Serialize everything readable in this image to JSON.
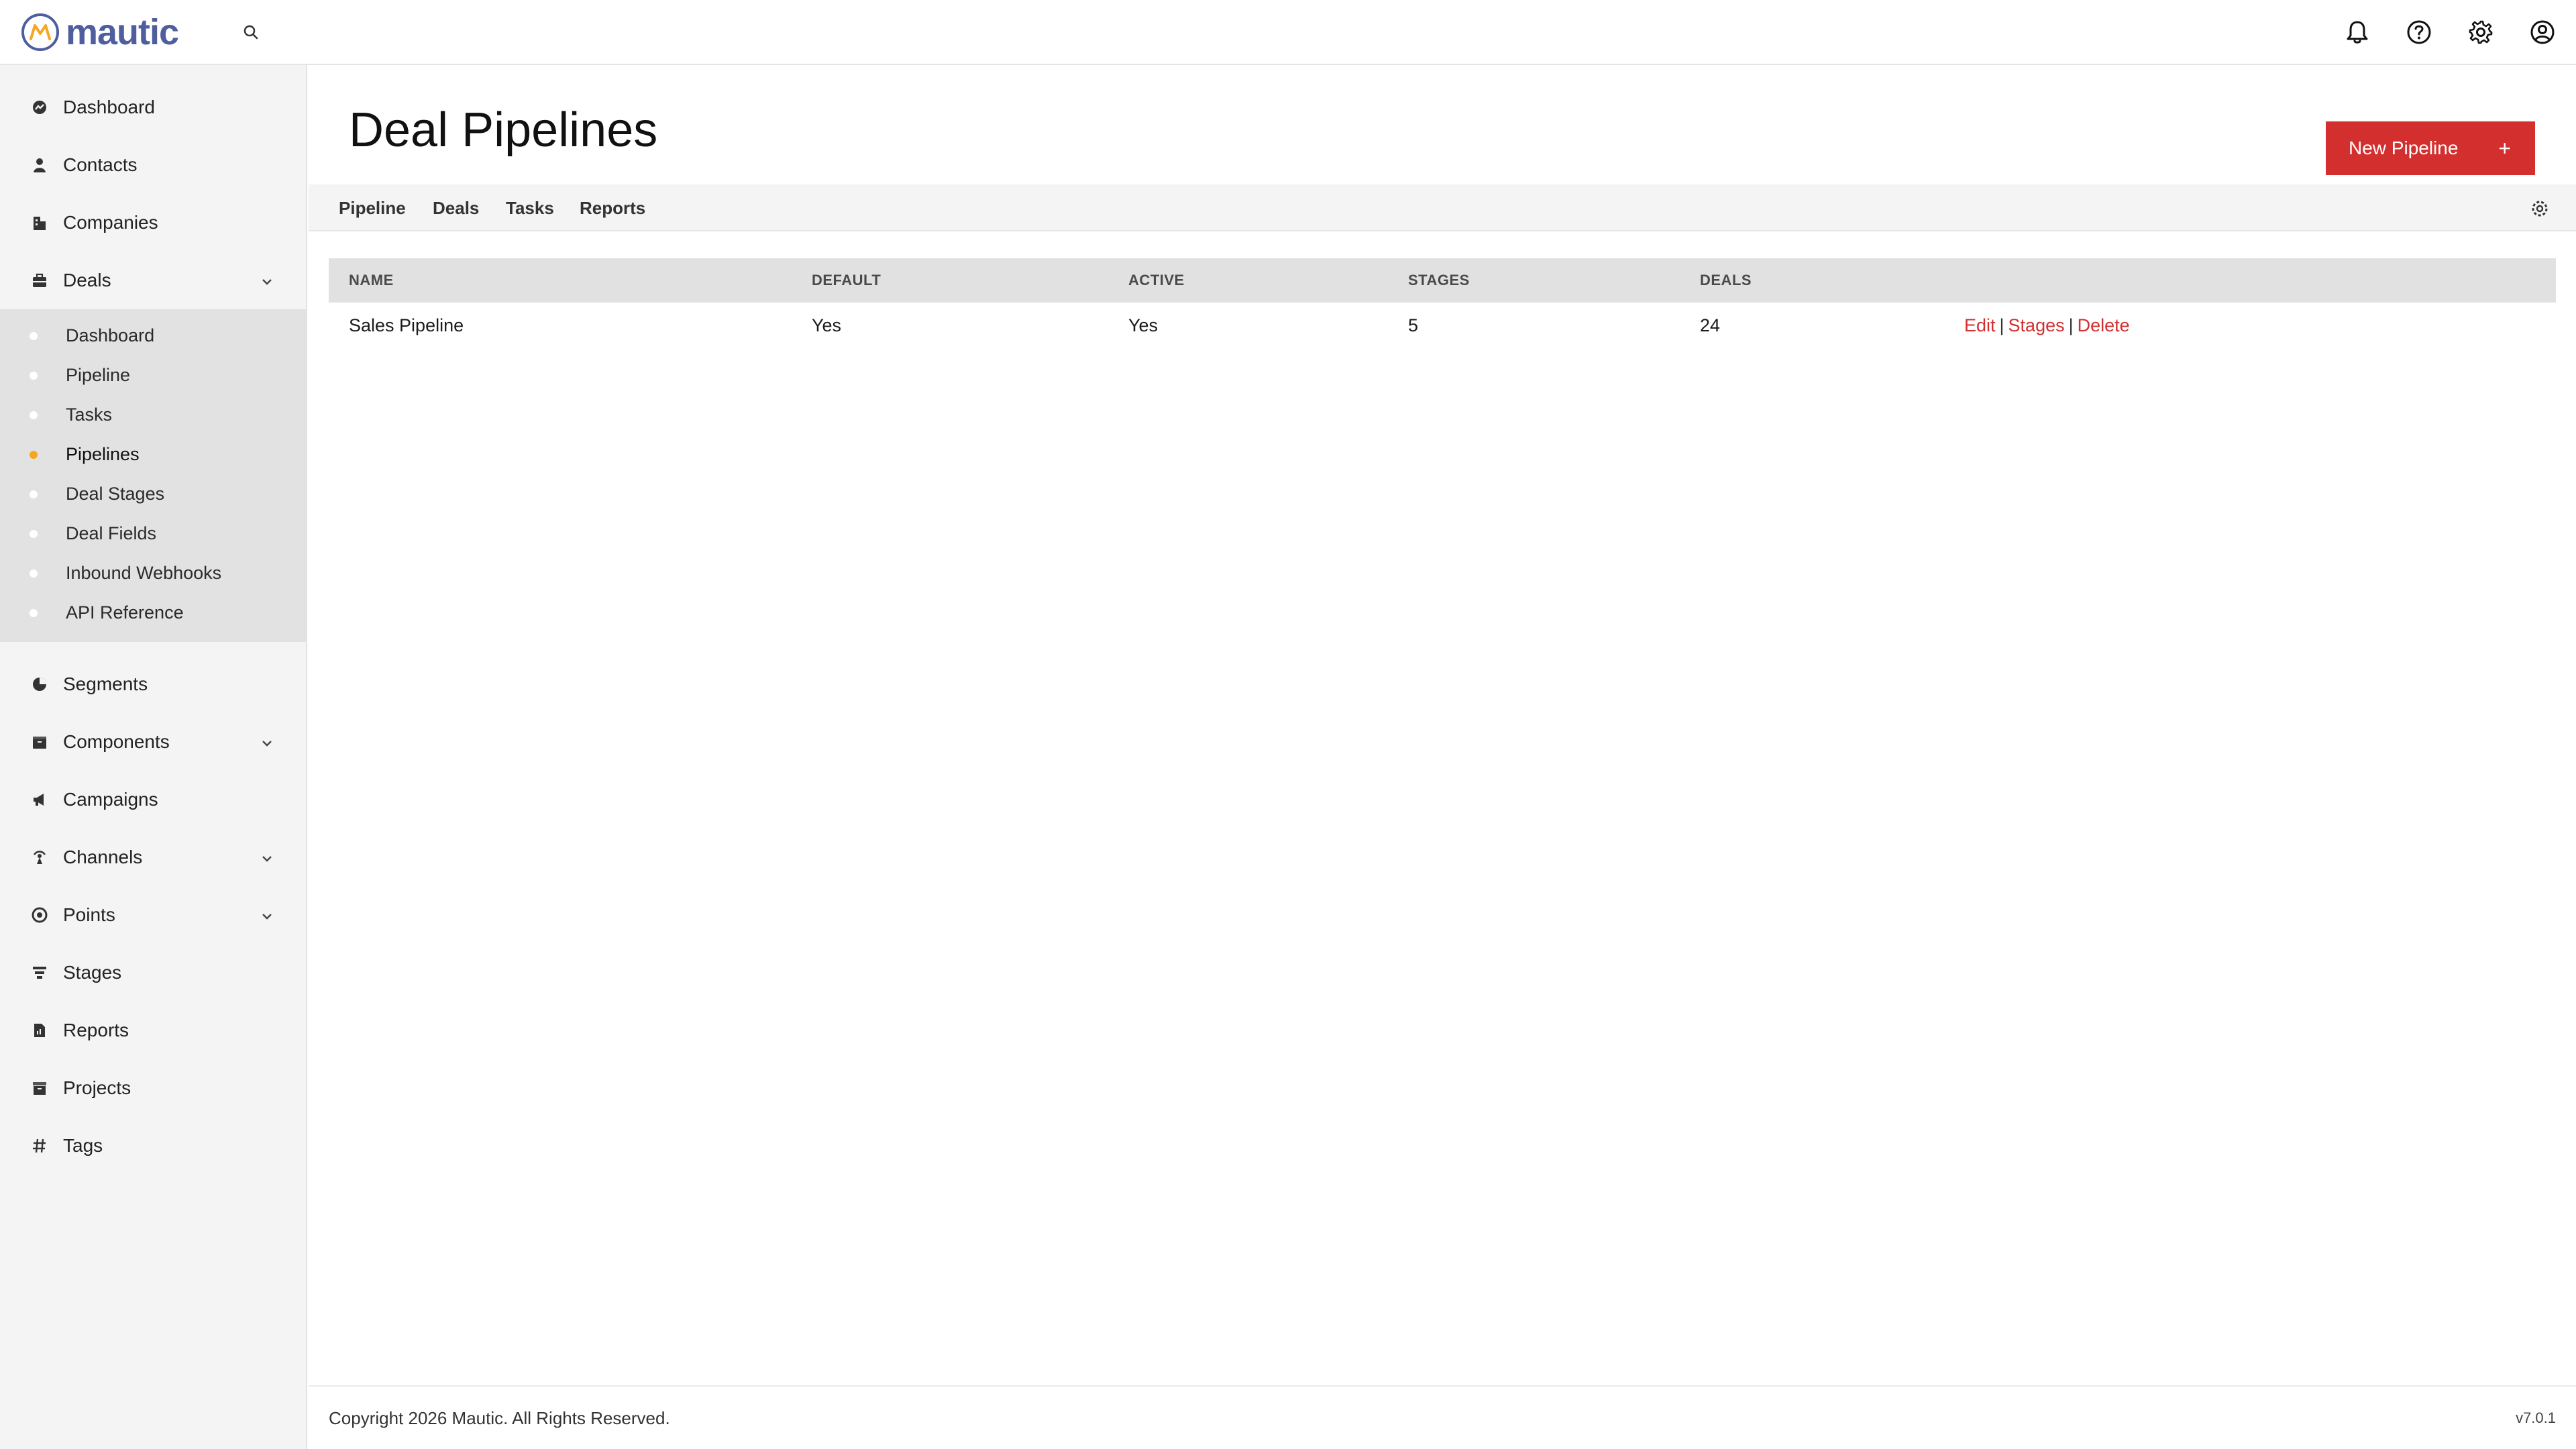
{
  "app": {
    "logo_text": "mautic",
    "brand_colors": {
      "logo": "#4e5e9e",
      "logo_accent": "#f5a623",
      "primary": "#d32f2f"
    }
  },
  "topbar": {
    "icons": [
      "search-icon",
      "bell-icon",
      "help-icon",
      "gear-icon",
      "user-circle-icon"
    ]
  },
  "sidebar": {
    "items_top": [
      {
        "label": "Dashboard",
        "icon": "dashboard-icon"
      },
      {
        "label": "Contacts",
        "icon": "person-icon"
      },
      {
        "label": "Companies",
        "icon": "building-icon"
      },
      {
        "label": "Deals",
        "icon": "briefcase-icon",
        "expandable": true
      }
    ],
    "deals_submenu": [
      {
        "label": "Dashboard"
      },
      {
        "label": "Pipeline"
      },
      {
        "label": "Tasks"
      },
      {
        "label": "Pipelines",
        "active": true
      },
      {
        "label": "Deal Stages"
      },
      {
        "label": "Deal Fields"
      },
      {
        "label": "Inbound Webhooks"
      },
      {
        "label": "API Reference"
      }
    ],
    "items_bottom": [
      {
        "label": "Segments",
        "icon": "pie-icon"
      },
      {
        "label": "Components",
        "icon": "box-icon",
        "expandable": true
      },
      {
        "label": "Campaigns",
        "icon": "megaphone-icon"
      },
      {
        "label": "Channels",
        "icon": "broadcast-icon",
        "expandable": true
      },
      {
        "label": "Points",
        "icon": "points-icon",
        "expandable": true
      },
      {
        "label": "Stages",
        "icon": "filter-icon"
      },
      {
        "label": "Reports",
        "icon": "report-icon"
      },
      {
        "label": "Projects",
        "icon": "folder-icon"
      },
      {
        "label": "Tags",
        "icon": "hash-icon"
      }
    ]
  },
  "main": {
    "title": "Deal Pipelines",
    "new_button_label": "New Pipeline",
    "new_button_plus": "+",
    "tabs": [
      "Pipeline",
      "Deals",
      "Tasks",
      "Reports"
    ],
    "table": {
      "headers": [
        "NAME",
        "DEFAULT",
        "ACTIVE",
        "STAGES",
        "DEALS"
      ],
      "rows": [
        {
          "name": "Sales Pipeline",
          "default": "Yes",
          "active": "Yes",
          "stages": "5",
          "deals": "24",
          "actions": [
            "Edit",
            "Stages",
            "Delete"
          ],
          "separator": "|"
        }
      ]
    }
  },
  "footer": {
    "copyright": "Copyright 2026 Mautic. All Rights Reserved.",
    "version": "v7.0.1"
  }
}
